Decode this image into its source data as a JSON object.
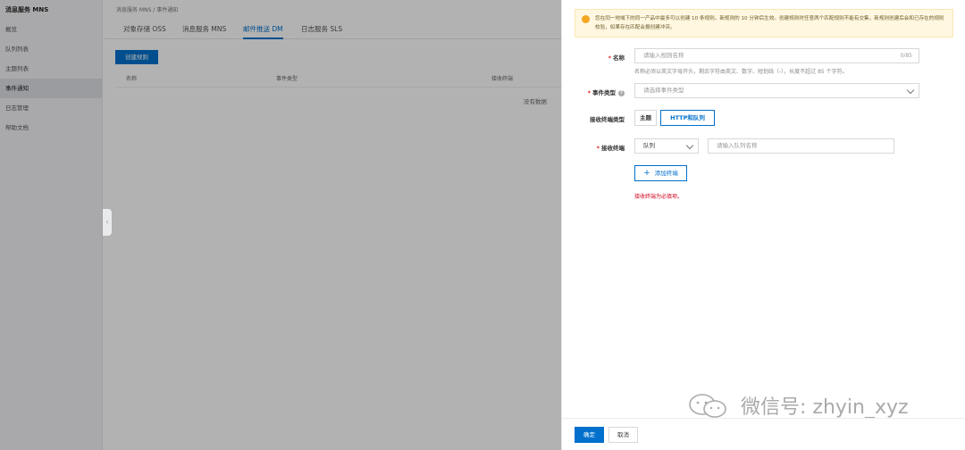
{
  "sidebar": {
    "product": "消息服务 MNS",
    "items": [
      {
        "label": "概览"
      },
      {
        "label": "队列列表"
      },
      {
        "label": "主题列表"
      },
      {
        "label": "事件通知"
      },
      {
        "label": "日志管理"
      },
      {
        "label": "帮助文档"
      }
    ]
  },
  "main": {
    "breadcrumb": "消息服务 MNS  /  事件通知",
    "tabs": [
      {
        "label": "对象存储 OSS"
      },
      {
        "label": "消息服务 MNS"
      },
      {
        "label": "邮件推送 DM"
      },
      {
        "label": "日志服务 SLS"
      }
    ],
    "create_label": "创建规则",
    "columns": [
      "名称",
      "事件类型",
      "接收终端"
    ],
    "empty_text": "没有数据"
  },
  "drawer": {
    "notice": "您在同一地域下的同一产品中最多可以创建 10 条规则。新规则的 10 分钟后生效。创建规则时任意两个匹配规则不能有交集，新规则创建后会和已存在的规则校验，如果存在匹配会报创建冲突。",
    "name": {
      "label": "名称",
      "placeholder": "请输入规则名称",
      "counter": "0/85",
      "help": "名称必须以英文字母开头，剩余字符由英文、数字、短划线（-），长度不超过 85 个字符。"
    },
    "event_type": {
      "label": "事件类型",
      "placeholder": "请选择事件类型"
    },
    "endpoint_type": {
      "label": "接收终端类型",
      "options": [
        "主题",
        "HTTP和队列"
      ],
      "selected": "HTTP和队列"
    },
    "endpoint": {
      "label": "接收终端",
      "select_value": "队列",
      "placeholder": "请输入队列名称"
    },
    "add_label": "添加终端",
    "error": "接收终端为必填项。",
    "ok_label": "确定",
    "cancel_label": "取消",
    "watermark": "微信号: zhyin_xyz"
  },
  "colors": {
    "primary": "#0070cc",
    "error": "#d0021b",
    "notice_bg": "#fff7e0",
    "warning_icon": "#f5a623"
  }
}
